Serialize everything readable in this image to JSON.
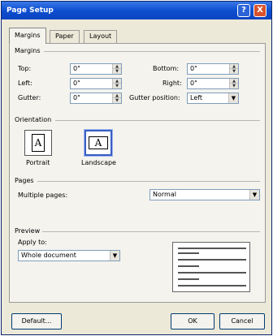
{
  "title": "Page Setup",
  "titlebar_buttons": {
    "help": "?",
    "close": "X"
  },
  "tabs": [
    "Margins",
    "Paper",
    "Layout"
  ],
  "margins": {
    "group_label": "Margins",
    "top_label": "Top:",
    "top_value": "0\"",
    "left_label": "Left:",
    "left_value": "0\"",
    "gutter_label": "Gutter:",
    "gutter_value": "0\"",
    "bottom_label": "Bottom:",
    "bottom_value": "0\"",
    "right_label": "Right:",
    "right_value": "0\"",
    "gutter_position_label": "Gutter position:",
    "gutter_position_value": "Left"
  },
  "orientation": {
    "group_label": "Orientation",
    "portrait_label": "Portrait",
    "landscape_label": "Landscape",
    "icon_glyph": "A",
    "selected": "Landscape"
  },
  "pages": {
    "group_label": "Pages",
    "multiple_pages_label": "Multiple pages:",
    "multiple_pages_value": "Normal"
  },
  "preview": {
    "group_label": "Preview",
    "apply_to_label": "Apply to:",
    "apply_to_value": "Whole document"
  },
  "buttons": {
    "default": "Default...",
    "ok": "OK",
    "cancel": "Cancel"
  }
}
